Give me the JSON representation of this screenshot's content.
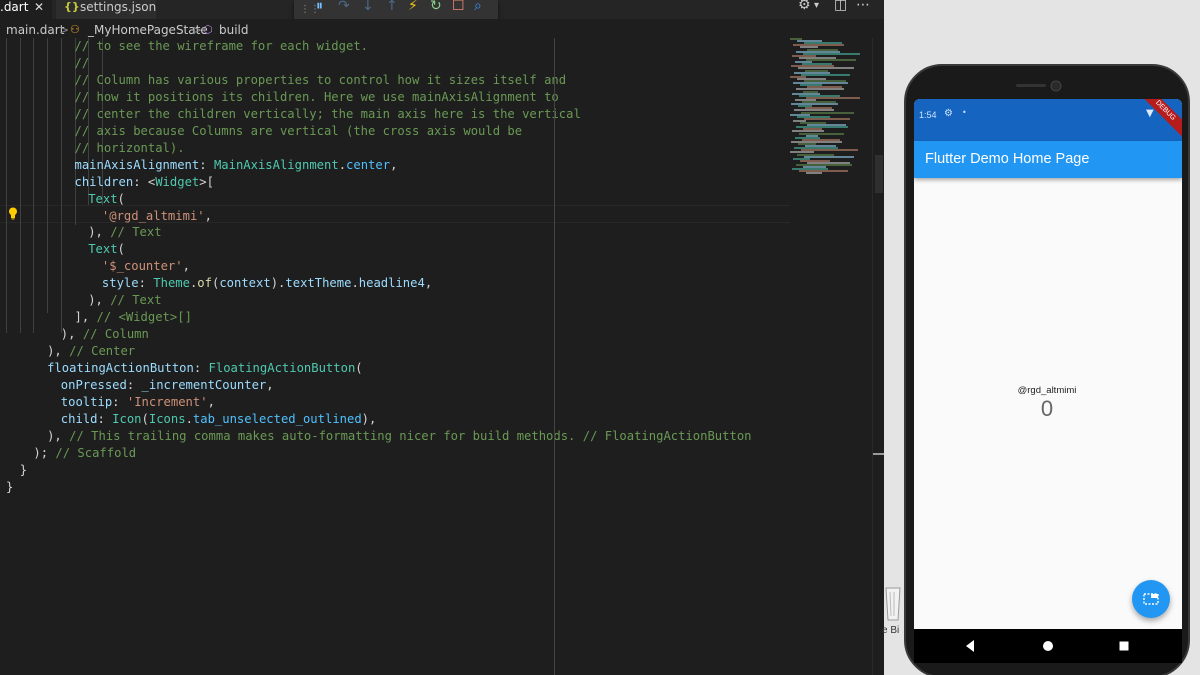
{
  "tabs": {
    "active": {
      "label": ".dart",
      "close": "✕"
    },
    "second": {
      "icon_text": "{}",
      "label": "settings.json"
    }
  },
  "breadcrumb": {
    "file": "main.dart",
    "sep": ">",
    "class_name": "_MyHomePageState",
    "method": "build"
  },
  "code_lines": [
    [
      [
        "c",
        "// to see the wireframe for each widget."
      ]
    ],
    [
      [
        "c",
        "//"
      ]
    ],
    [
      [
        "c",
        "// Column has various properties to control how it sizes itself and"
      ]
    ],
    [
      [
        "c",
        "// how it positions its children. Here we use mainAxisAlignment to"
      ]
    ],
    [
      [
        "c",
        "// center the children vertically; the main axis here is the vertical"
      ]
    ],
    [
      [
        "c",
        "// axis because Columns are vertical (the cross axis would be"
      ]
    ],
    [
      [
        "c",
        "// horizontal)."
      ]
    ],
    [
      [
        "k",
        "mainAxisAlignment"
      ],
      [
        "p",
        ": "
      ],
      [
        "t",
        "MainAxisAlignment"
      ],
      [
        "p",
        "."
      ],
      [
        "b",
        "center"
      ],
      [
        "p",
        ","
      ]
    ],
    [
      [
        "k",
        "children"
      ],
      [
        "p",
        ": <"
      ],
      [
        "t",
        "Widget"
      ],
      [
        "p",
        ">["
      ]
    ],
    [
      [
        "t",
        "Text"
      ],
      [
        "p",
        "("
      ]
    ],
    [
      [
        "s",
        "'@rgd_altmimi'"
      ],
      [
        "p",
        ","
      ]
    ],
    [
      [
        "p",
        "), "
      ],
      [
        "c",
        "// Text"
      ]
    ],
    [
      [
        "t",
        "Text"
      ],
      [
        "p",
        "("
      ]
    ],
    [
      [
        "s",
        "'$_counter'"
      ],
      [
        "p",
        ","
      ]
    ],
    [
      [
        "k",
        "style"
      ],
      [
        "p",
        ": "
      ],
      [
        "t",
        "Theme"
      ],
      [
        "p",
        "."
      ],
      [
        "f",
        "of"
      ],
      [
        "p",
        "("
      ],
      [
        "k",
        "context"
      ],
      [
        "p",
        ")."
      ],
      [
        "k",
        "textTheme"
      ],
      [
        "p",
        "."
      ],
      [
        "k",
        "headline4"
      ],
      [
        "p",
        ","
      ]
    ],
    [
      [
        "p",
        "), "
      ],
      [
        "c",
        "// Text"
      ]
    ],
    [
      [
        "p",
        "], "
      ],
      [
        "c",
        "// <Widget>[]"
      ]
    ],
    [
      [
        "p",
        "), "
      ],
      [
        "c",
        "// Column"
      ]
    ],
    [
      [
        "p",
        "), "
      ],
      [
        "c",
        "// Center"
      ]
    ],
    [
      [
        "k",
        "floatingActionButton"
      ],
      [
        "p",
        ": "
      ],
      [
        "t",
        "FloatingActionButton"
      ],
      [
        "p",
        "("
      ]
    ],
    [
      [
        "k",
        "onPressed"
      ],
      [
        "p",
        ": "
      ],
      [
        "k",
        "_incrementCounter"
      ],
      [
        "p",
        ","
      ]
    ],
    [
      [
        "k",
        "tooltip"
      ],
      [
        "p",
        ": "
      ],
      [
        "s",
        "'Increment'"
      ],
      [
        "p",
        ","
      ]
    ],
    [
      [
        "k",
        "child"
      ],
      [
        "p",
        ": "
      ],
      [
        "t",
        "Icon"
      ],
      [
        "p",
        "("
      ],
      [
        "t",
        "Icons"
      ],
      [
        "p",
        "."
      ],
      [
        "b",
        "tab_unselected_outlined"
      ],
      [
        "p",
        "),"
      ]
    ],
    [
      [
        "p",
        "), "
      ],
      [
        "c",
        "// This trailing comma makes auto-formatting nicer for build methods. "
      ],
      [
        "c",
        "// FloatingActionButton"
      ]
    ],
    [
      [
        "p",
        "); "
      ],
      [
        "c",
        "// Scaffold"
      ]
    ],
    [
      [
        "p",
        "}"
      ]
    ],
    [
      [
        "p",
        "}"
      ]
    ]
  ],
  "desktop": {
    "recycle_label": "e Bi"
  },
  "phone": {
    "status_time": "1:54",
    "debug_banner": "DEBUG",
    "app_title": "Flutter Demo Home Page",
    "username_text": "@rgd_altmimi",
    "counter_value": "0"
  },
  "colors": {
    "accent": "#2196f3",
    "status": "#1565c0",
    "editor_bg": "#1e1e1e"
  }
}
